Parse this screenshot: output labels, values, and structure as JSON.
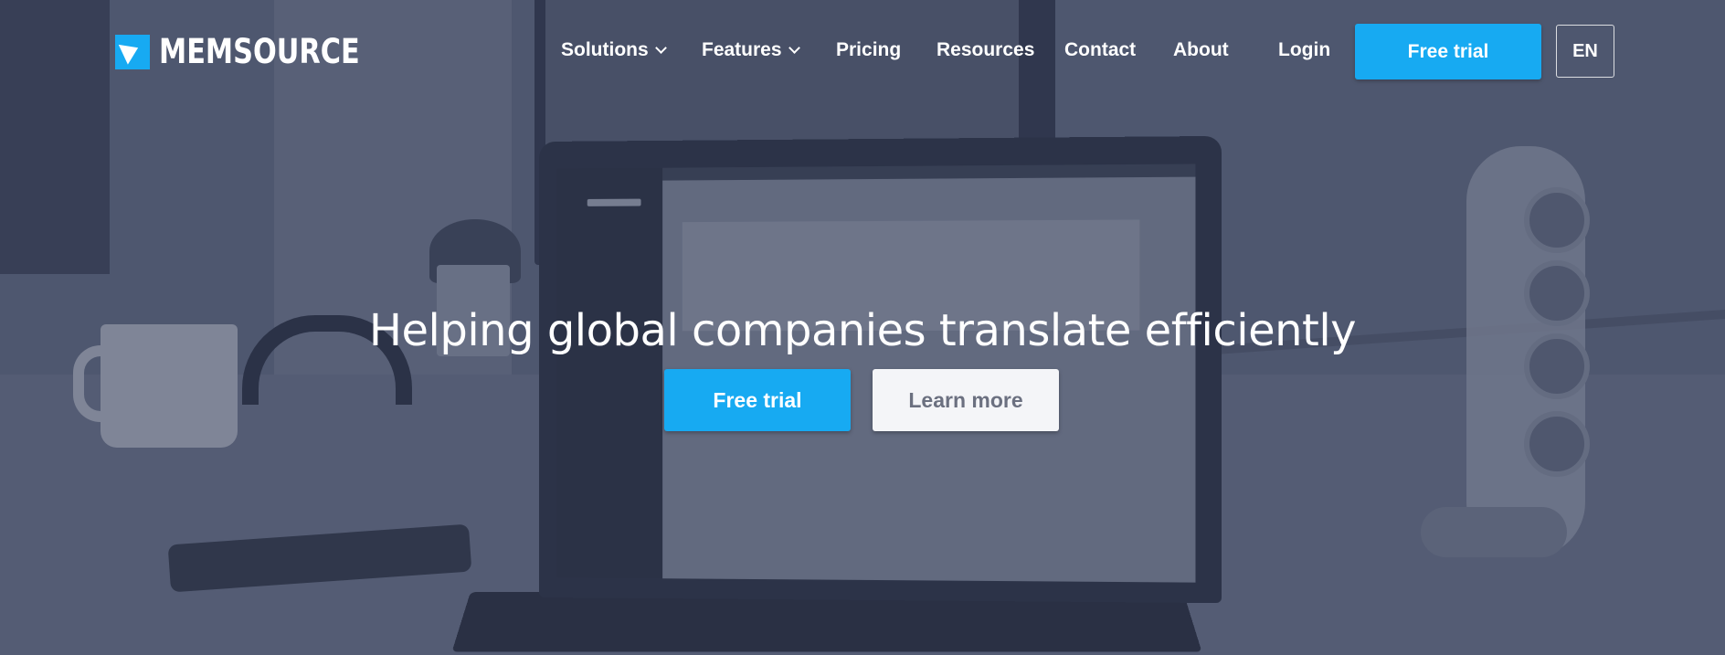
{
  "brand": {
    "name": "MEMSOURCE",
    "logo_icon": "memsource-logo-icon",
    "accent_color": "#17aaf2"
  },
  "nav": {
    "items": [
      {
        "label": "Solutions",
        "has_dropdown": true
      },
      {
        "label": "Features",
        "has_dropdown": true
      },
      {
        "label": "Pricing",
        "has_dropdown": false
      },
      {
        "label": "Resources",
        "has_dropdown": false
      },
      {
        "label": "Contact",
        "has_dropdown": false
      },
      {
        "label": "About",
        "has_dropdown": false
      }
    ],
    "login_label": "Login",
    "free_trial_label": "Free trial",
    "language_label": "EN"
  },
  "hero": {
    "headline": "Helping global companies translate efficiently",
    "primary_cta": "Free trial",
    "secondary_cta": "Learn more"
  }
}
